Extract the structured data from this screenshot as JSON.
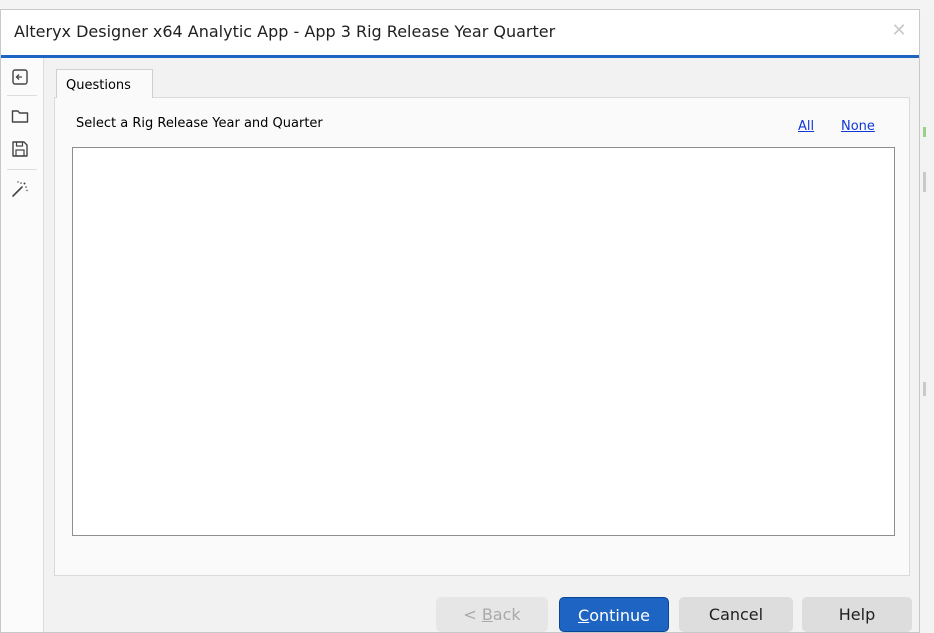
{
  "window": {
    "title": "Alteryx Designer x64 Analytic App - App 3 Rig Release Year Quarter",
    "close_glyph": "✕"
  },
  "toolbar": {
    "icons": [
      "collapse-panel-icon",
      "open-folder-icon",
      "save-icon",
      "magic-wand-icon"
    ]
  },
  "tabs": [
    {
      "label": "Questions"
    }
  ],
  "question": {
    "label": "Select a Rig Release Year and Quarter",
    "select_all_label": "All",
    "select_none_label": "None",
    "items": []
  },
  "footer": {
    "back": {
      "label": "< Back",
      "mnemonic": "B"
    },
    "continue": {
      "label": "Continue",
      "mnemonic": "C"
    },
    "cancel": {
      "label": "Cancel"
    },
    "help": {
      "label": "Help"
    }
  },
  "colors": {
    "accent": "#1e65c3",
    "link": "#0f38d6",
    "disabled_text": "#a9a9a9"
  }
}
